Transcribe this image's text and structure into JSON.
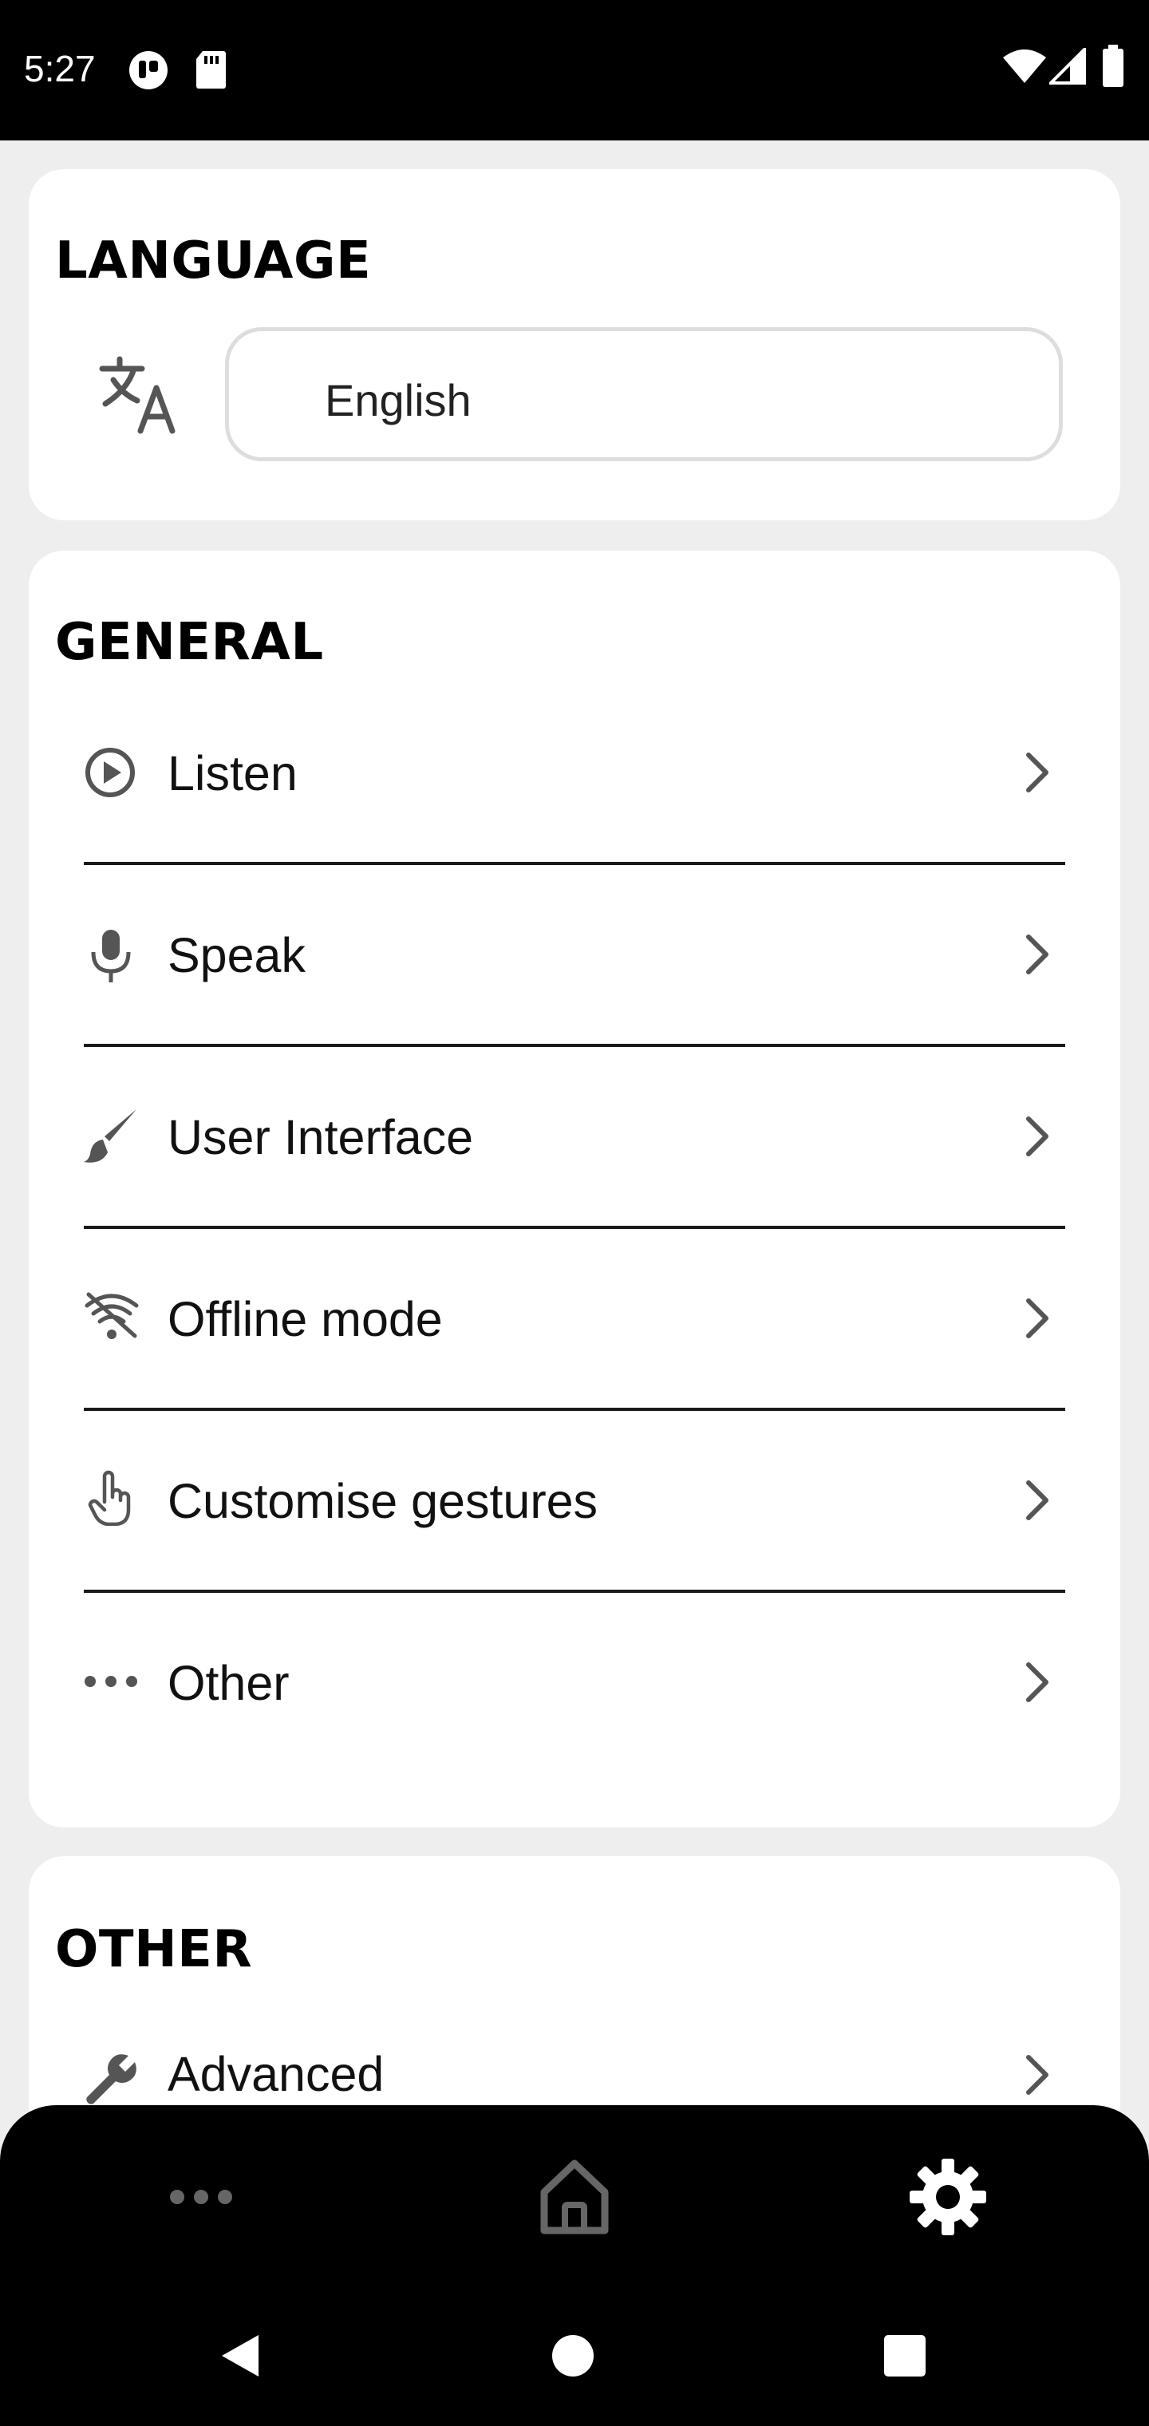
{
  "status_bar": {
    "time": "5:27"
  },
  "language_card": {
    "title": "LANGUAGE",
    "selected_language": "English"
  },
  "general_card": {
    "title": "GENERAL",
    "items": [
      {
        "label": "Listen",
        "icon": "play-circle-icon"
      },
      {
        "label": "Speak",
        "icon": "microphone-icon"
      },
      {
        "label": "User Interface",
        "icon": "paintbrush-icon"
      },
      {
        "label": "Offline mode",
        "icon": "wifi-off-icon"
      },
      {
        "label": "Customise gestures",
        "icon": "hand-pointer-icon"
      },
      {
        "label": "Other",
        "icon": "more-dots-icon"
      }
    ]
  },
  "other_card": {
    "title": "OTHER",
    "items": [
      {
        "label": "Advanced",
        "icon": "wrench-icon"
      }
    ]
  },
  "bottom_nav": {
    "items": [
      {
        "name": "more",
        "icon": "more-dots-icon",
        "active": false
      },
      {
        "name": "home",
        "icon": "home-icon",
        "active": false
      },
      {
        "name": "settings",
        "icon": "gear-icon",
        "active": true
      }
    ]
  },
  "colors": {
    "background": "#eeeeee",
    "card": "#ffffff",
    "nav": "#000000",
    "inactive_icon": "#666666",
    "active_icon": "#ffffff"
  }
}
